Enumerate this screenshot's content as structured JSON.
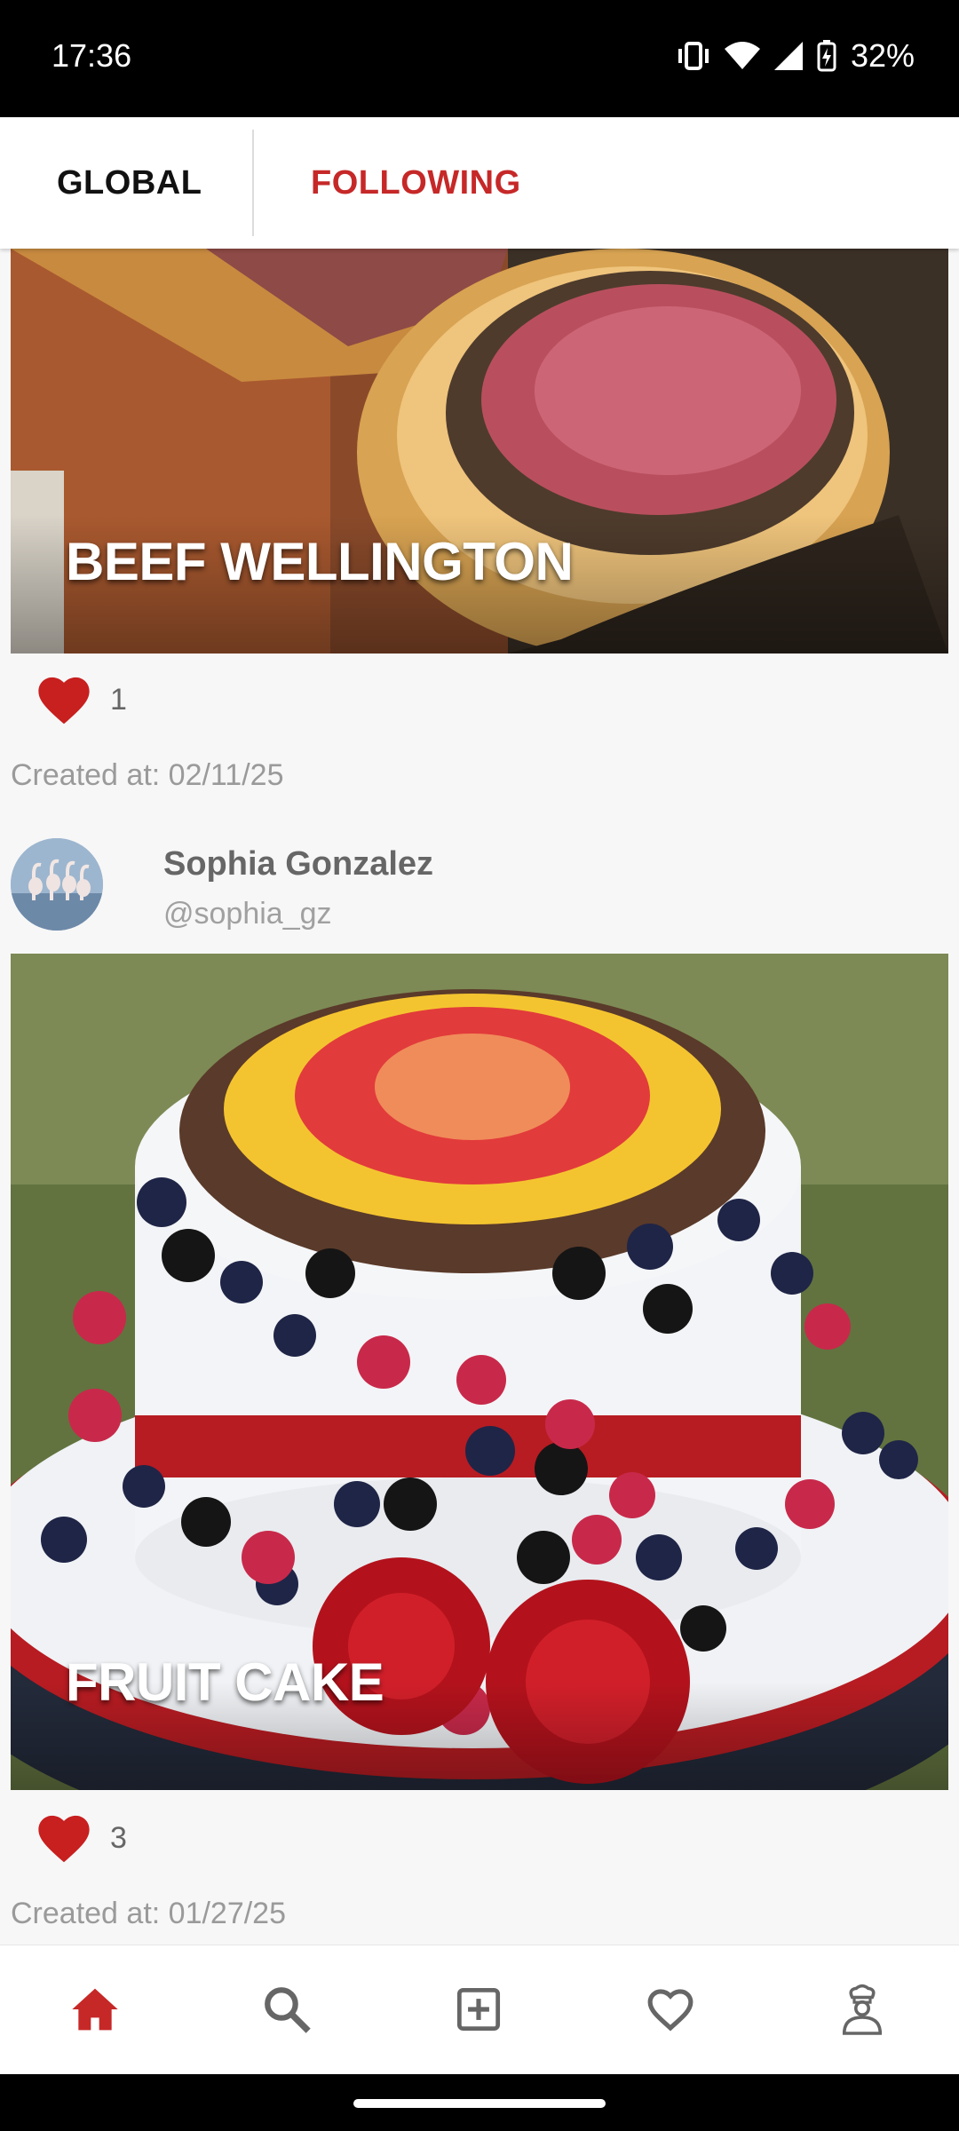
{
  "status_bar": {
    "time": "17:36",
    "battery": "32%"
  },
  "tabs": {
    "global": "GLOBAL",
    "following": "FOLLOWING"
  },
  "posts": [
    {
      "title": "BEEF WELLINGTON",
      "likes": "1",
      "created": "Created at: 02/11/25"
    },
    {
      "author_name": "Sophia Gonzalez",
      "author_handle": "@sophia_gz",
      "title": "FRUIT CAKE",
      "likes": "3",
      "created": "Created at: 01/27/25"
    }
  ],
  "nav": [
    "home-icon",
    "search-icon",
    "add-box-icon",
    "heart-outline-icon",
    "chef-icon"
  ],
  "colors": {
    "accent": "#c62828",
    "heart": "#c81f1f",
    "background": "#f7f7f7"
  }
}
